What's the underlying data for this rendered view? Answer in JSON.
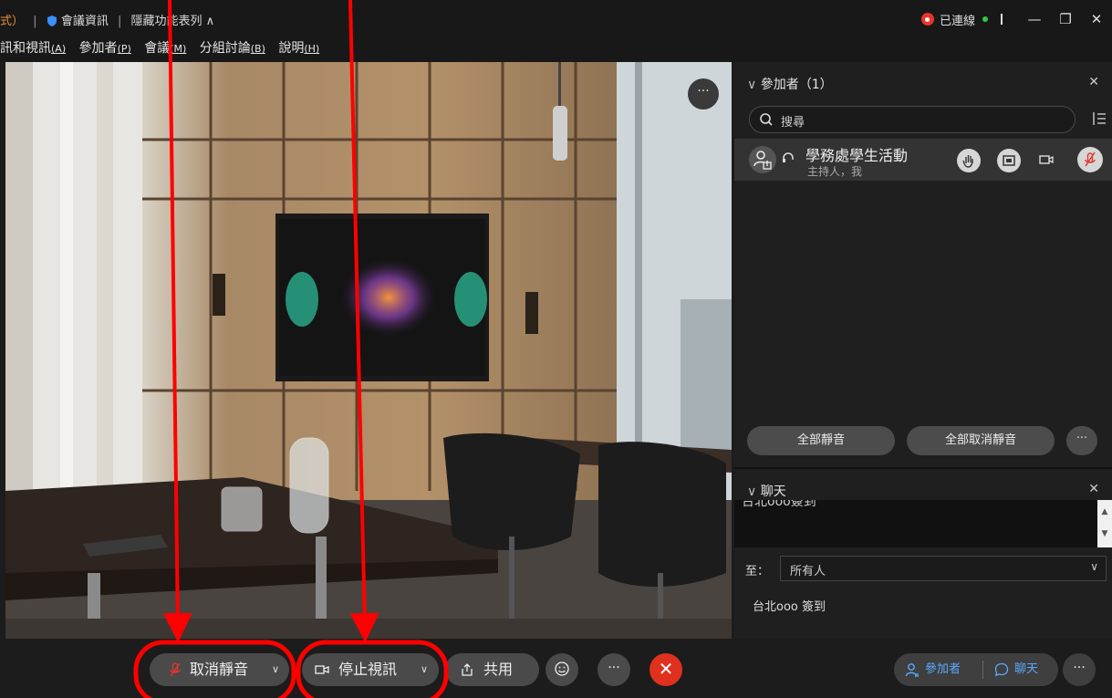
{
  "titlebar": {
    "mode_fragment": "式）",
    "meeting_info": "會議資訊",
    "hide_menubar": "隱藏功能表列 ∧",
    "connected": "已連線"
  },
  "window_controls": {
    "minimize": "—",
    "restore": "❐",
    "close": "✕"
  },
  "menubar": [
    {
      "label": "訊和視訊",
      "key": "(A)"
    },
    {
      "label": "參加者",
      "key": "(P)"
    },
    {
      "label": "會議",
      "key": "(M)"
    },
    {
      "label": "分組討論",
      "key": "(B)"
    },
    {
      "label": "說明",
      "key": "(H)"
    }
  ],
  "video": {
    "more_label": "···"
  },
  "participants_panel": {
    "title": "參加者（1）",
    "close": "✕",
    "search_placeholder": "搜尋",
    "participant": {
      "name": "學務處學生活動",
      "role": "主持人，我"
    },
    "mute_all": "全部靜音",
    "unmute_all": "全部取消靜音",
    "more": "···"
  },
  "chat_panel": {
    "title": "聊天",
    "close": "✕",
    "cut_text": "台北ooo簽到",
    "to_label": "至：",
    "to_value": "所有人",
    "to_chevron": "∨",
    "message": "台北ooo 簽到"
  },
  "toolbar": {
    "unmute": "取消靜音",
    "stop_video": "停止視訊",
    "share": "共用",
    "more": "···",
    "leave": "✕",
    "chevron": "∨",
    "participants": "參加者",
    "chat": "聊天",
    "right_more": "···"
  },
  "colors": {
    "accent_blue": "#5aa9ff",
    "leave_red": "#e0301e",
    "annotation_red": "#ff0000",
    "muted_mic_red": "#e5362d"
  }
}
